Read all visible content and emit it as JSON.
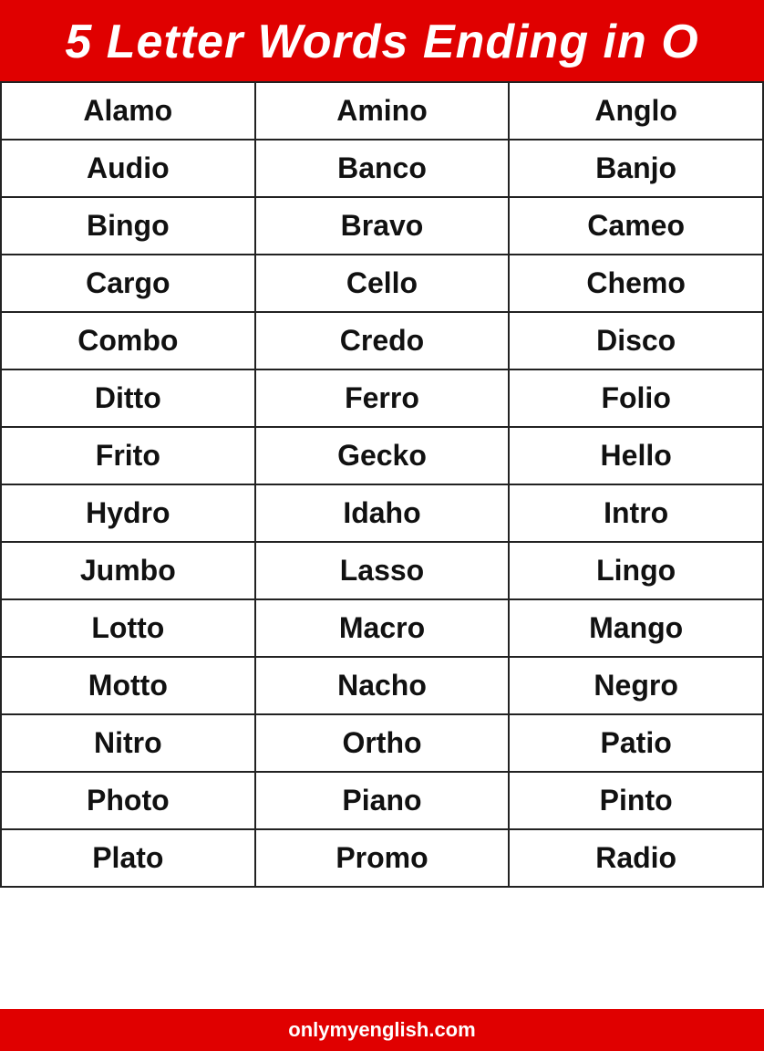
{
  "header": {
    "title": "5 Letter Words Ending in O"
  },
  "rows": [
    [
      "Alamo",
      "Amino",
      "Anglo"
    ],
    [
      "Audio",
      "Banco",
      "Banjo"
    ],
    [
      "Bingo",
      "Bravo",
      "Cameo"
    ],
    [
      "Cargo",
      "Cello",
      "Chemo"
    ],
    [
      "Combo",
      "Credo",
      "Disco"
    ],
    [
      "Ditto",
      "Ferro",
      "Folio"
    ],
    [
      "Frito",
      "Gecko",
      "Hello"
    ],
    [
      "Hydro",
      "Idaho",
      "Intro"
    ],
    [
      "Jumbo",
      "Lasso",
      "Lingo"
    ],
    [
      "Lotto",
      "Macro",
      "Mango"
    ],
    [
      "Motto",
      "Nacho",
      "Negro"
    ],
    [
      "Nitro",
      "Ortho",
      "Patio"
    ],
    [
      "Photo",
      "Piano",
      "Pinto"
    ],
    [
      "Plato",
      "Promo",
      "Radio"
    ]
  ],
  "footer": {
    "url": "onlymyenglish.com"
  }
}
